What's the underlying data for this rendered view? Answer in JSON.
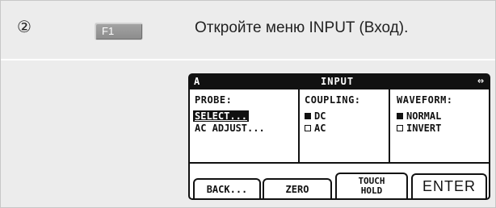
{
  "step": {
    "number": "②",
    "key_label": "F1",
    "instruction": "Откройте меню INPUT (Вход)."
  },
  "screen": {
    "mode": "A",
    "title": "INPUT",
    "nav_glyph": "⇔",
    "columns": [
      {
        "heading": "PROBE:",
        "options": [
          {
            "label": "SELECT...",
            "highlighted": true
          },
          {
            "label": "AC ADJUST...",
            "highlighted": false
          }
        ]
      },
      {
        "heading": "COUPLING:",
        "options": [
          {
            "label": "DC",
            "checked": true
          },
          {
            "label": "AC",
            "checked": false
          }
        ]
      },
      {
        "heading": "WAVEFORM:",
        "options": [
          {
            "label": "NORMAL",
            "checked": true
          },
          {
            "label": "INVERT",
            "checked": false
          }
        ]
      }
    ],
    "softkeys": [
      {
        "line1": "BACK...",
        "line2": ""
      },
      {
        "line1": "ZERO",
        "line2": ""
      },
      {
        "line1": "TOUCH",
        "line2": "HOLD"
      },
      {
        "line1": "ENTER",
        "line2": ""
      }
    ]
  }
}
